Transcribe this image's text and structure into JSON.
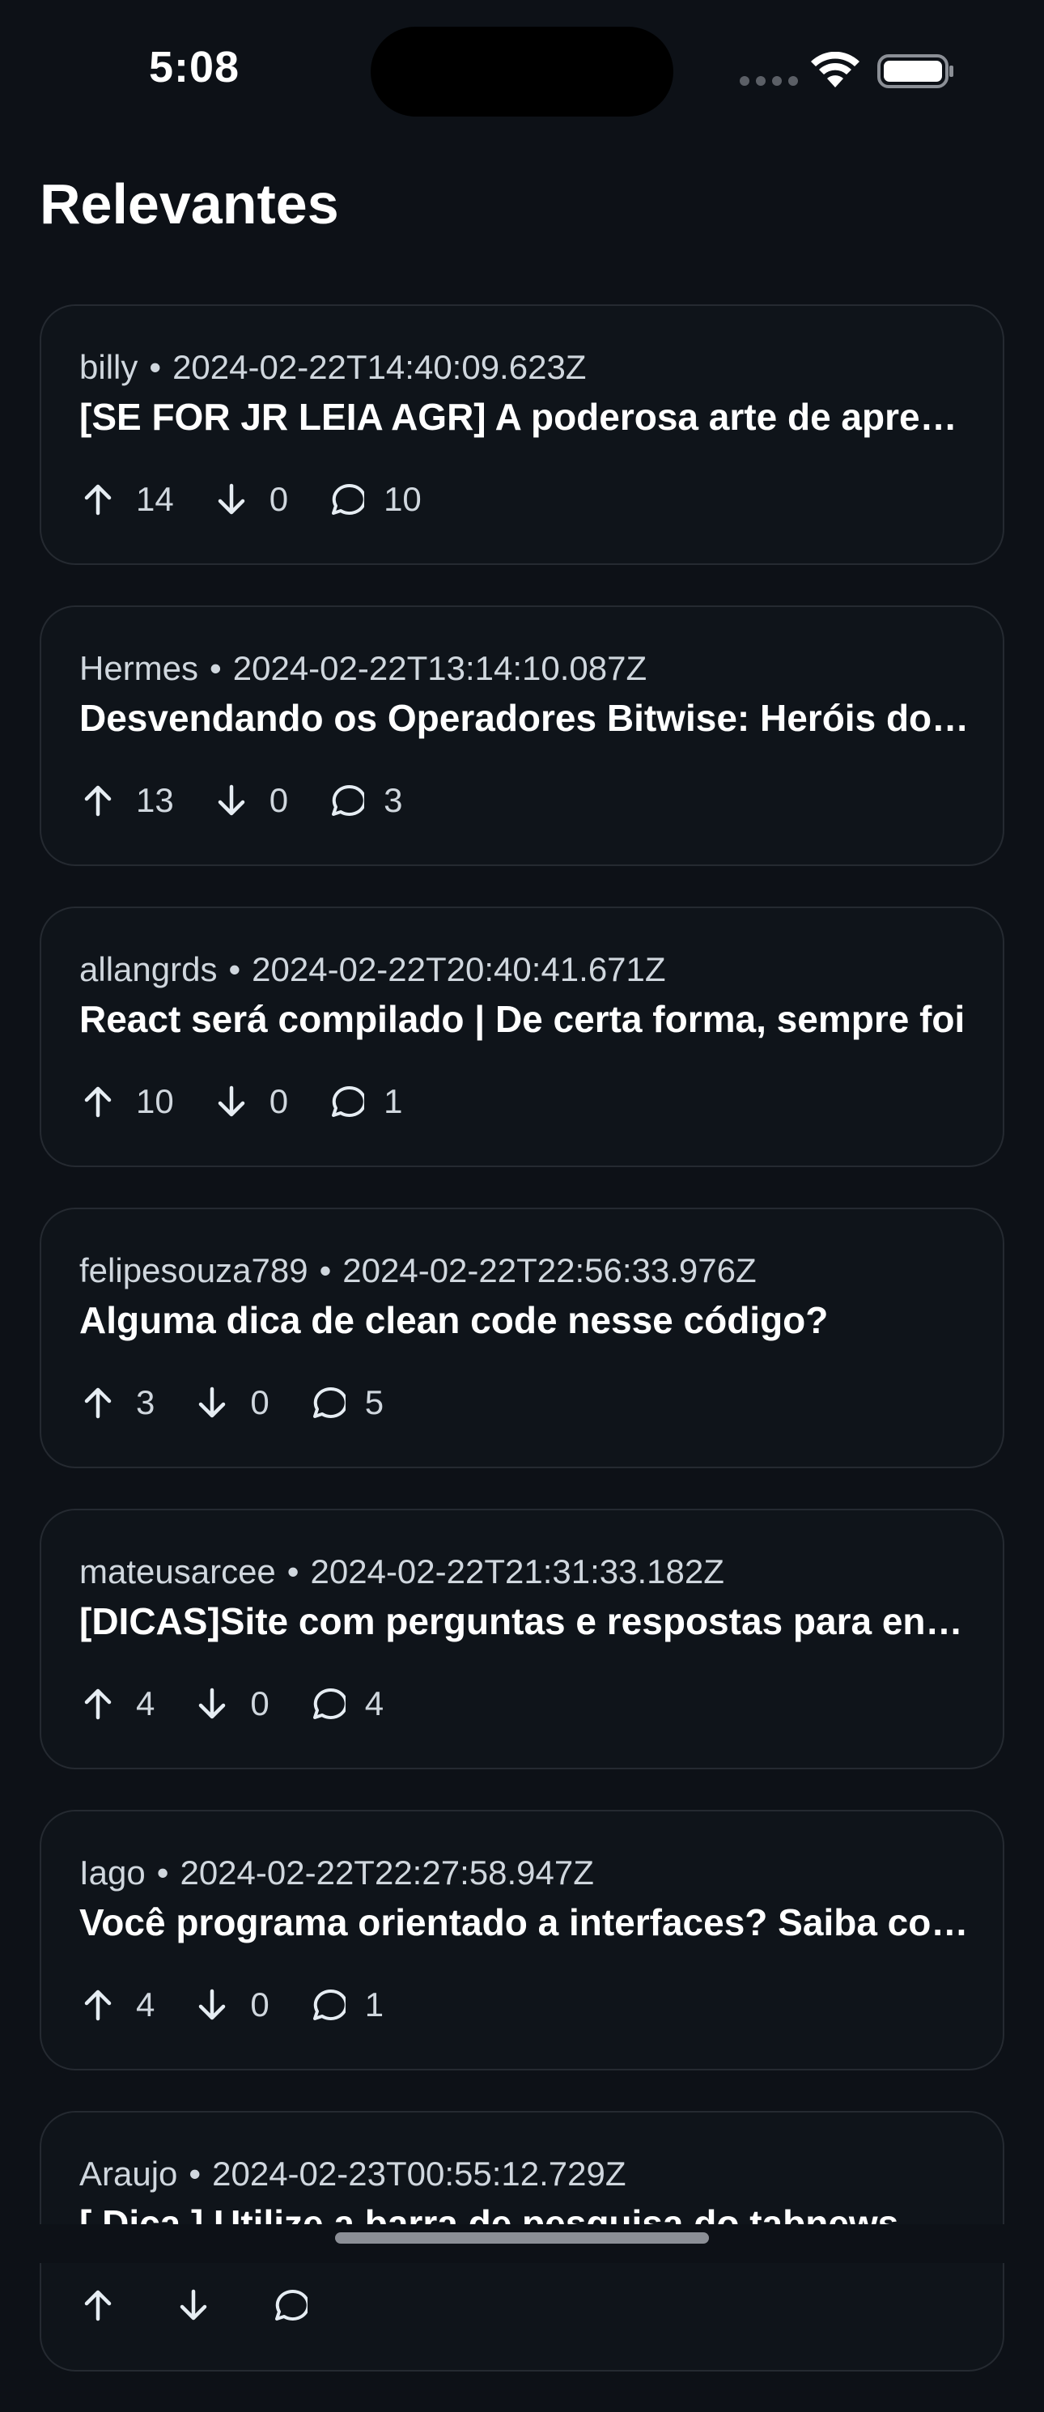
{
  "status_bar": {
    "time": "5:08"
  },
  "page": {
    "title": "Relevantes"
  },
  "posts": [
    {
      "author": "billy",
      "separator": "•",
      "date": "2024-02-22T14:40:09.623Z",
      "title": "[SE FOR JR LEIA AGR] A poderosa arte de aprender",
      "upvotes": "14",
      "downvotes": "0",
      "comments": "10"
    },
    {
      "author": "Hermes",
      "separator": "•",
      "date": "2024-02-22T13:14:10.087Z",
      "title": "Desvendando os Operadores Bitwise: Heróis do código",
      "upvotes": "13",
      "downvotes": "0",
      "comments": "3"
    },
    {
      "author": "allangrds",
      "separator": "•",
      "date": "2024-02-22T20:40:41.671Z",
      "title": "React será compilado | De certa forma, sempre foi",
      "upvotes": "10",
      "downvotes": "0",
      "comments": "1"
    },
    {
      "author": "felipesouza789",
      "separator": "•",
      "date": "2024-02-22T22:56:33.976Z",
      "title": "Alguma dica de clean code nesse código?",
      "upvotes": "3",
      "downvotes": "0",
      "comments": "5"
    },
    {
      "author": "mateusarcee",
      "separator": "•",
      "date": "2024-02-22T21:31:33.182Z",
      "title": "[DICAS]Site com perguntas e respostas para entrevistas",
      "upvotes": "4",
      "downvotes": "0",
      "comments": "4"
    },
    {
      "author": "Iago",
      "separator": "•",
      "date": "2024-02-22T22:27:58.947Z",
      "title": "Você programa orientado a interfaces? Saiba como",
      "upvotes": "4",
      "downvotes": "0",
      "comments": "1"
    },
    {
      "author": "Araujo",
      "separator": "•",
      "date": "2024-02-23T00:55:12.729Z",
      "title": "[ Dica ] Utilize a barra de pesquisa do tabnews",
      "upvotes": "",
      "downvotes": "",
      "comments": ""
    }
  ],
  "icons": {
    "upvote": "arrow-up-icon",
    "downvote": "arrow-down-icon",
    "comments": "comment-bubble-icon",
    "wifi": "wifi-icon",
    "battery": "battery-icon"
  },
  "colors": {
    "background": "#0d1117",
    "card_border": "#252a31",
    "text_primary": "#ffffff",
    "text_secondary": "#d0d7de"
  }
}
